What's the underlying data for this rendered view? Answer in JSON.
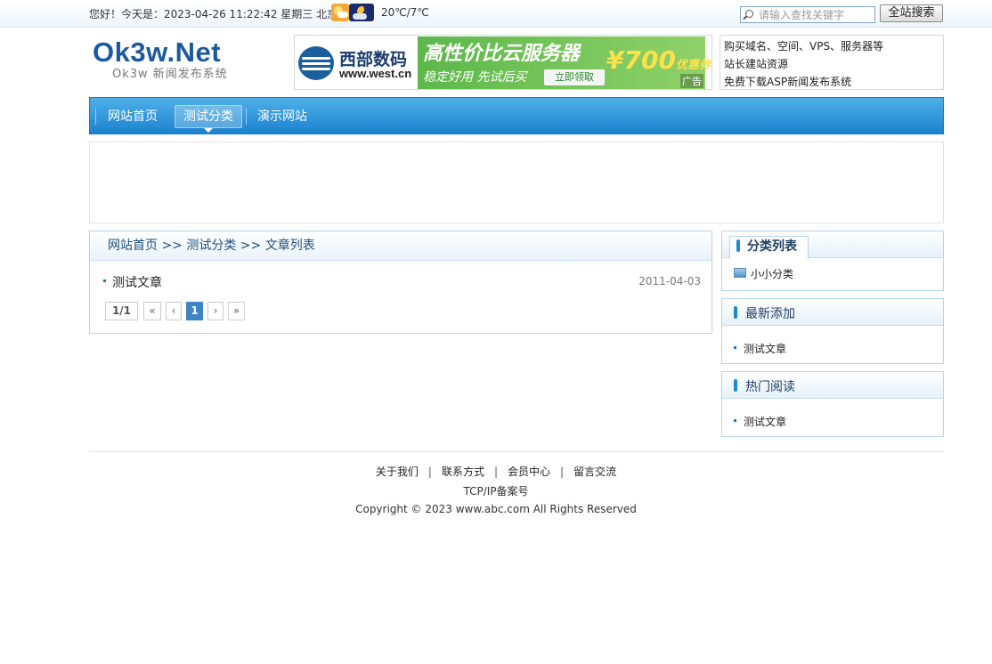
{
  "topbar": {
    "greeting": "您好！今天是：2023-04-26 11:22:42 星期三 北京",
    "weather_icons": [
      "sunny-cloudy-icon",
      "night-cloudy-icon"
    ],
    "temperature": "20℃/7℃",
    "search_placeholder": "请输入查找关键字",
    "search_button": "全站搜索"
  },
  "header": {
    "logo_text": "Ok3w.Net",
    "logo_subtitle": "Ok3w 新闻发布系统",
    "ad": {
      "brand": "西部数码",
      "url": "www.west.cn",
      "headline": "高性价比云服务器",
      "tagline": "稳定好用 先试后买",
      "cta": "立即领取",
      "price": "¥700",
      "price_suffix": "优惠券",
      "mark": "广告"
    },
    "quick_links": [
      "购买域名、空间、VPS、服务器等",
      "站长建站资源",
      "免费下载ASP新闻发布系统"
    ]
  },
  "nav": {
    "items": [
      "网站首页",
      "测试分类",
      "演示网站"
    ],
    "active_index": 1
  },
  "main": {
    "breadcrumb": "网站首页 >> 测试分类 >> 文章列表",
    "articles": [
      {
        "title": "测试文章",
        "date": "2011-04-03"
      }
    ],
    "pager": {
      "info": "1/1",
      "first": "«",
      "prev": "‹",
      "current": "1",
      "next": "›",
      "last": "»"
    }
  },
  "sidebar": {
    "categories": {
      "title": "分类列表",
      "items": [
        "小小分类"
      ]
    },
    "latest": {
      "title": "最新添加",
      "items": [
        "测试文章"
      ]
    },
    "hot": {
      "title": "热门阅读",
      "items": [
        "测试文章"
      ]
    }
  },
  "footer": {
    "links": [
      "关于我们",
      "联系方式",
      "会员中心",
      "留言交流"
    ],
    "separator": "|",
    "icp": "TCP/IP备案号",
    "copyright": "Copyright © 2023 www.abc.com All Rights Reserved"
  },
  "colors": {
    "nav_top": "#4fb0e8",
    "nav_bottom": "#1b82cf",
    "logo": "#1c5a9e",
    "panel_border": "#b8d3ea",
    "pager_current": "#3d85c6"
  }
}
